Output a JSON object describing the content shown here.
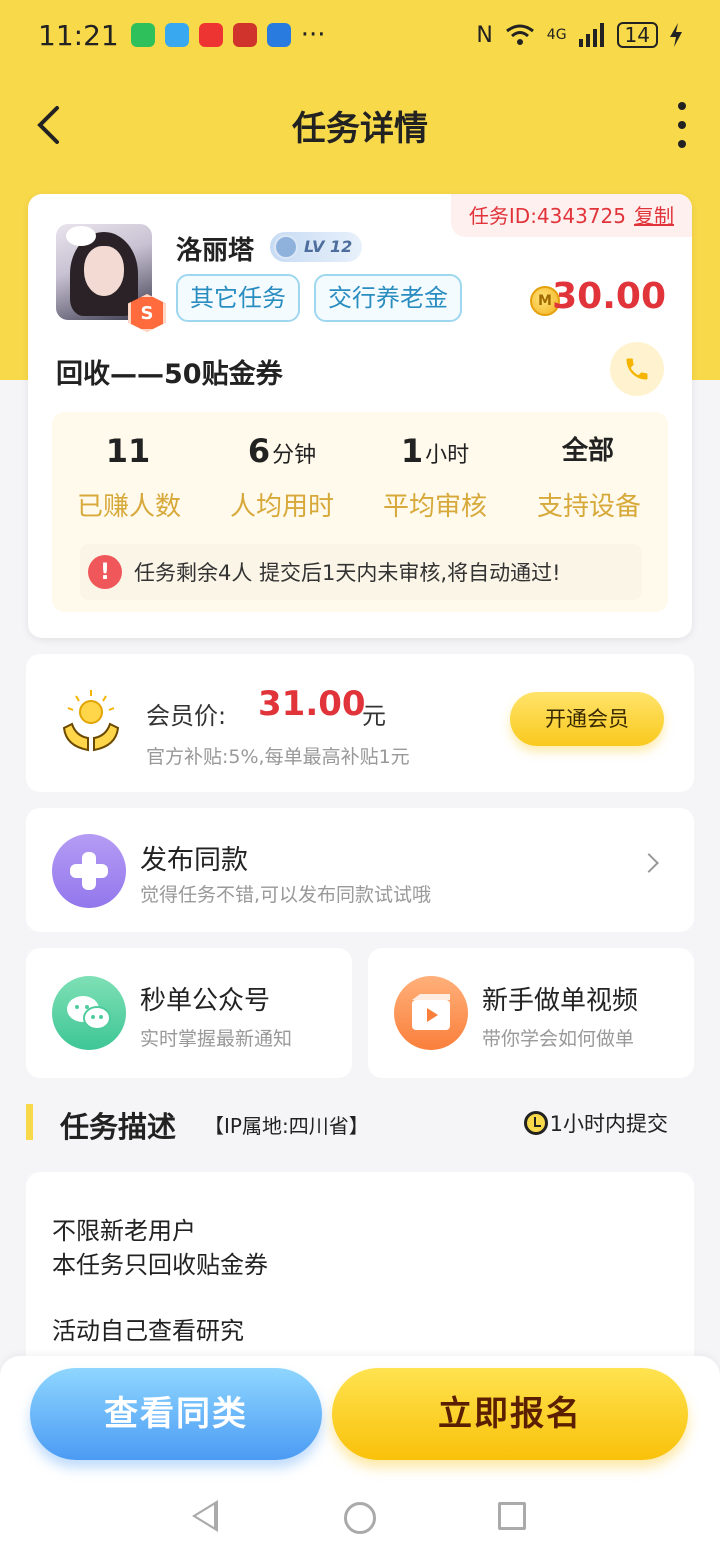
{
  "status_bar": {
    "time": "11:21",
    "dots": "···",
    "signal": "4G",
    "battery": "14"
  },
  "header": {
    "title": "任务详情"
  },
  "task": {
    "id_label": "任务ID:4343725",
    "copy_label": "复制",
    "user_name": "洛丽塔",
    "level": "LV 12",
    "badge": "S",
    "tags": [
      "其它任务",
      "交行养老金"
    ],
    "coin_symbol": "M",
    "price": "30.00",
    "title": "回收——50贴金券",
    "stats": [
      {
        "value": "11",
        "unit": "",
        "label": "已赚人数"
      },
      {
        "value": "6",
        "unit": "分钟",
        "label": "人均用时"
      },
      {
        "value": "1",
        "unit": "小时",
        "label": "平均审核"
      },
      {
        "value": "全部",
        "unit": "",
        "label": "支持设备"
      }
    ],
    "notice": "任务剩余4人  提交后1天内未审核,将自动通过!"
  },
  "member": {
    "label": "会员价:",
    "price": "31.00",
    "unit": "元",
    "subtitle": "官方补贴:5%,每单最高补贴1元",
    "button": "开通会员"
  },
  "publish": {
    "title": "发布同款",
    "subtitle": "觉得任务不错,可以发布同款试试哦"
  },
  "cards": [
    {
      "title": "秒单公众号",
      "subtitle": "实时掌握最新通知",
      "icon": "wechat-icon"
    },
    {
      "title": "新手做单视频",
      "subtitle": "带你学会如何做单",
      "icon": "video-icon"
    }
  ],
  "description": {
    "title": "任务描述",
    "ip": "【IP属地:四川省】",
    "time_limit": "1小时内提交",
    "lines": [
      "不限新老用户",
      "本任务只回收贴金券",
      "活动自己查看研究"
    ]
  },
  "actions": {
    "similar": "查看同类",
    "signup": "立即报名"
  },
  "colors": {
    "brand_yellow": "#f8d94a",
    "price_red": "#e0343a",
    "tag_blue": "#2a8dc0"
  }
}
